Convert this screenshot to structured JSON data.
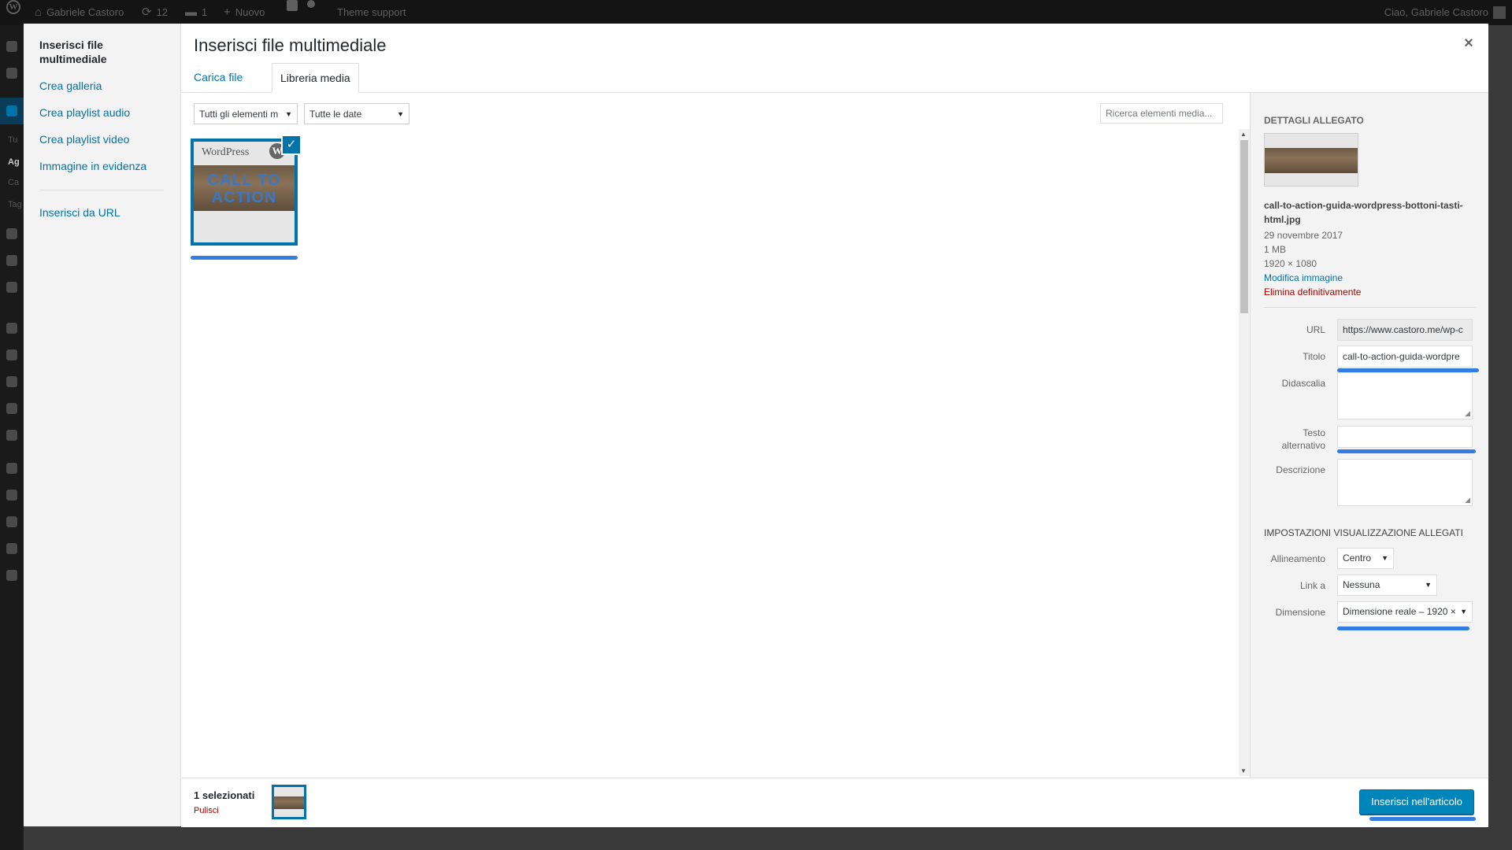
{
  "admin_bar": {
    "site_name": "Gabriele Castoro",
    "updates_count": "12",
    "comments_count": "1",
    "new_label": "Nuovo",
    "theme_support": "Theme support",
    "greeting": "Ciao, Gabriele Castoro"
  },
  "admin_menu": {
    "partial_labels": [
      "Tu",
      "Ag",
      "Ca",
      "Tag"
    ]
  },
  "modal": {
    "title": "Inserisci file multimediale",
    "close_glyph": "×",
    "menu": {
      "active": "Inserisci file multimediale",
      "items": [
        "Crea galleria",
        "Crea playlist audio",
        "Crea playlist video",
        "Immagine in evidenza"
      ],
      "insert_url": "Inserisci da URL"
    },
    "tabs": [
      "Carica file",
      "Libreria media"
    ],
    "active_tab": "Libreria media",
    "filters": {
      "type_selected": "Tutti gli elementi m",
      "date_selected": "Tutte le date",
      "search_placeholder": "Ricerca elementi media..."
    },
    "media_item": {
      "logo_text": "WordPress",
      "wp_glyph": "W",
      "cta_line1": "CALL TO",
      "cta_line2": "ACTION",
      "selected": true
    },
    "details": {
      "heading": "Dettagli allegato",
      "filename": "call-to-action-guida-wordpress-bottoni-tasti-html.jpg",
      "date": "29 novembre 2017",
      "size": "1 MB",
      "dimensions": "1920 × 1080",
      "edit_link": "Modifica immagine",
      "delete_link": "Elimina definitivamente",
      "fields": {
        "url_label": "URL",
        "url_value": "https://www.castoro.me/wp-c",
        "title_label": "Titolo",
        "title_value": "call-to-action-guida-wordpre",
        "caption_label": "Didascalia",
        "alt_label_1": "Testo",
        "alt_label_2": "alternativo",
        "description_label": "Descrizione"
      }
    },
    "display_settings": {
      "heading": "Impostazioni visualizzazione allegati",
      "alignment_label": "Allineamento",
      "alignment_value": "Centro",
      "link_label": "Link a",
      "link_value": "Nessuna",
      "size_label": "Dimensione",
      "size_value": "Dimensione reale – 1920 ×"
    },
    "toolbar": {
      "selected_count": "1 selezionati",
      "clear_label": "Pulisci",
      "insert_button": "Inserisci nell'articolo"
    }
  },
  "colors": {
    "accent": "#0073aa",
    "button": "#0085ba",
    "danger": "#a00",
    "highlight": "#1d6fe0"
  }
}
